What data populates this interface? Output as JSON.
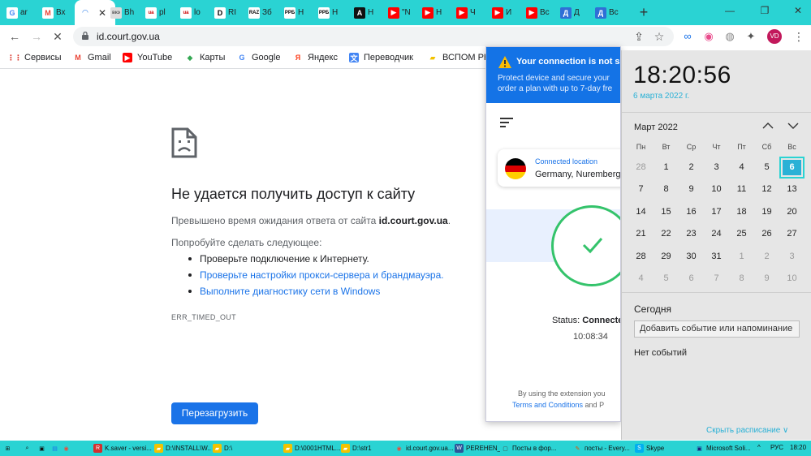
{
  "tabs": [
    {
      "icon": "G",
      "label": "ar",
      "color": "#4285f4",
      "bg": "#fff"
    },
    {
      "icon": "M",
      "label": "Вх",
      "color": "#ea4335",
      "bg": "#fff"
    },
    {
      "icon": "◠",
      "label": "",
      "color": "#1a73e8",
      "bg": "#fff"
    },
    {
      "icon": "вкэ",
      "label": "Вh",
      "color": "#555",
      "bg": "#ddd"
    },
    {
      "icon": "ua",
      "label": "pl",
      "color": "#c00",
      "bg": "#fff"
    },
    {
      "icon": "ua",
      "label": "lo",
      "color": "#c00",
      "bg": "#fff"
    },
    {
      "icon": "D",
      "label": "RI",
      "color": "#000",
      "bg": "#fff"
    },
    {
      "icon": "RAZ",
      "label": "Зб",
      "color": "#000",
      "bg": "#fff"
    },
    {
      "icon": "РРБ",
      "label": "Н",
      "color": "#000",
      "bg": "#fff"
    },
    {
      "icon": "РРБ",
      "label": "Н",
      "color": "#000",
      "bg": "#fff"
    },
    {
      "icon": "A",
      "label": "Н",
      "color": "#fff",
      "bg": "#111"
    },
    {
      "icon": "▶",
      "label": "\"N",
      "color": "#fff",
      "bg": "#f00"
    },
    {
      "icon": "▶",
      "label": "Н",
      "color": "#fff",
      "bg": "#f00"
    },
    {
      "icon": "▶",
      "label": "Ч",
      "color": "#fff",
      "bg": "#f00"
    },
    {
      "icon": "▶",
      "label": "И",
      "color": "#fff",
      "bg": "#f00"
    },
    {
      "icon": "▶",
      "label": "Вс",
      "color": "#fff",
      "bg": "#f00"
    },
    {
      "icon": "Д",
      "label": "Д",
      "color": "#fff",
      "bg": "#2f6fd6"
    },
    {
      "icon": "Д",
      "label": "Вс",
      "color": "#fff",
      "bg": "#2f6fd6"
    }
  ],
  "active_tab_close": "✕",
  "new_tab": "+",
  "window_controls": [
    "—",
    "❐",
    "✕"
  ],
  "address": {
    "url": "id.court.gov.ua",
    "back": "←",
    "forward": "→",
    "reload": "✕",
    "share": "⇪",
    "star": "☆"
  },
  "extensions": [
    {
      "icon": "∞",
      "color": "#1a73e8"
    },
    {
      "icon": "◉",
      "color": "#e94b8c"
    },
    {
      "icon": "◍",
      "color": "#888"
    },
    {
      "icon": "✦",
      "color": "#555"
    },
    {
      "icon": "VD",
      "color": "#c2185b"
    }
  ],
  "menu": "⋮",
  "bookmarks": [
    {
      "icon": "⋮⋮",
      "label": "Сервисы",
      "color": "#d93025",
      "bg": "transparent"
    },
    {
      "icon": "M",
      "label": "Gmail",
      "color": "#ea4335",
      "bg": "transparent"
    },
    {
      "icon": "▶",
      "label": "YouTube",
      "color": "#fff",
      "bg": "#f00"
    },
    {
      "icon": "◆",
      "label": "Карты",
      "color": "#34a853",
      "bg": "transparent"
    },
    {
      "icon": "G",
      "label": "Google",
      "color": "#4285f4",
      "bg": "transparent"
    },
    {
      "icon": "Я",
      "label": "Яндекс",
      "color": "#fc3f1d",
      "bg": "transparent"
    },
    {
      "icon": "文",
      "label": "Переводчик",
      "color": "#fff",
      "bg": "#4285f4"
    },
    {
      "icon": "▰",
      "label": "ВСПОМ РН",
      "color": "#f2c200",
      "bg": "transparent"
    }
  ],
  "error": {
    "title": "Не удается получить доступ к сайту",
    "line1_pre": "Превышено время ожидания ответа от сайта ",
    "line1_host": "id.court.gov.ua",
    "line1_post": ".",
    "try_label": "Попробуйте сделать следующее:",
    "suggestions": [
      {
        "text": "Проверьте подключение к Интернету.",
        "link": false
      },
      {
        "text": "Проверьте настройки прокси-сервера и брандмауэра.",
        "link": true
      },
      {
        "text": "Выполните диагностику сети в Windows",
        "link": true
      }
    ],
    "code": "ERR_TIMED_OUT",
    "reload": "Перезагрузить"
  },
  "vpn": {
    "banner_title": "Your connection is not s",
    "banner_text1": "Protect device and secure your",
    "banner_text2": "order a plan with up to 7-day fre",
    "location_label": "Connected location",
    "location": "Germany, Nuremberg",
    "status_label": "Status: ",
    "status_value": "Connecte",
    "time": "10:08:34",
    "foot1": "By using the extension you",
    "foot2_link": "Terms and Conditions",
    "foot2_rest": " and P",
    "colors": {
      "banner": "#1473e6",
      "accent": "#34c36b"
    }
  },
  "clock": {
    "time": "18:20:56",
    "date": "6 марта 2022 г.",
    "month": "Март 2022",
    "weekdays": [
      "Пн",
      "Вт",
      "Ср",
      "Чт",
      "Пт",
      "Сб",
      "Вс"
    ],
    "weeks": [
      [
        "28",
        "1",
        "2",
        "3",
        "4",
        "5",
        "6"
      ],
      [
        "7",
        "8",
        "9",
        "10",
        "11",
        "12",
        "13"
      ],
      [
        "14",
        "15",
        "16",
        "17",
        "18",
        "19",
        "20"
      ],
      [
        "21",
        "22",
        "23",
        "24",
        "25",
        "26",
        "27"
      ],
      [
        "28",
        "29",
        "30",
        "31",
        "1",
        "2",
        "3"
      ],
      [
        "4",
        "5",
        "6",
        "7",
        "8",
        "9",
        "10"
      ]
    ],
    "today_label": "Сегодня",
    "add_event": "Добавить событие или напоминание",
    "no_events": "Нет событий",
    "schedule": "Скрыть расписание ∨",
    "accent": "#2ab1d6"
  },
  "taskbar": {
    "items": [
      {
        "icon": "⊞",
        "label": "",
        "bg": "transparent",
        "color": "#111"
      },
      {
        "icon": "⌕",
        "label": "",
        "bg": "transparent",
        "color": "#111"
      },
      {
        "icon": "▣",
        "label": "",
        "bg": "transparent",
        "color": "#111"
      },
      {
        "icon": "▤",
        "label": "",
        "bg": "transparent",
        "color": "#1a73e8"
      },
      {
        "icon": "◉",
        "label": "",
        "bg": "transparent",
        "color": "#e94b3c"
      },
      {
        "icon": "R",
        "label": "K.saver - versi...",
        "bg": "#d32f2f",
        "color": "#fff"
      },
      {
        "icon": "▰",
        "label": "D:\\INSTALL\\W...",
        "bg": "#f2c200",
        "color": "#fff"
      },
      {
        "icon": "▰",
        "label": "D:\\",
        "bg": "#f2c200",
        "color": "#fff"
      },
      {
        "icon": "▰",
        "label": "D:\\0001HTML...",
        "bg": "#f2c200",
        "color": "#fff"
      },
      {
        "icon": "▰",
        "label": "D:\\str1",
        "bg": "#f2c200",
        "color": "#fff"
      },
      {
        "icon": "◉",
        "label": "id.court.gov.ua...",
        "bg": "transparent",
        "color": "#e94b3c"
      },
      {
        "icon": "W",
        "label": "PEREHEN_D...",
        "bg": "#2b579a",
        "color": "#fff"
      },
      {
        "icon": "▢",
        "label": "Посты в фор...",
        "bg": "transparent",
        "color": "#444"
      },
      {
        "icon": "✎",
        "label": "посты - Every...",
        "bg": "transparent",
        "color": "#e65100"
      },
      {
        "icon": "S",
        "label": "Skype",
        "bg": "#00aff0",
        "color": "#fff"
      },
      {
        "icon": "▣",
        "label": "Microsoft Soli...",
        "bg": "transparent",
        "color": "#1a237e"
      }
    ],
    "tray": [
      "^",
      "РУС",
      "18:20"
    ]
  }
}
